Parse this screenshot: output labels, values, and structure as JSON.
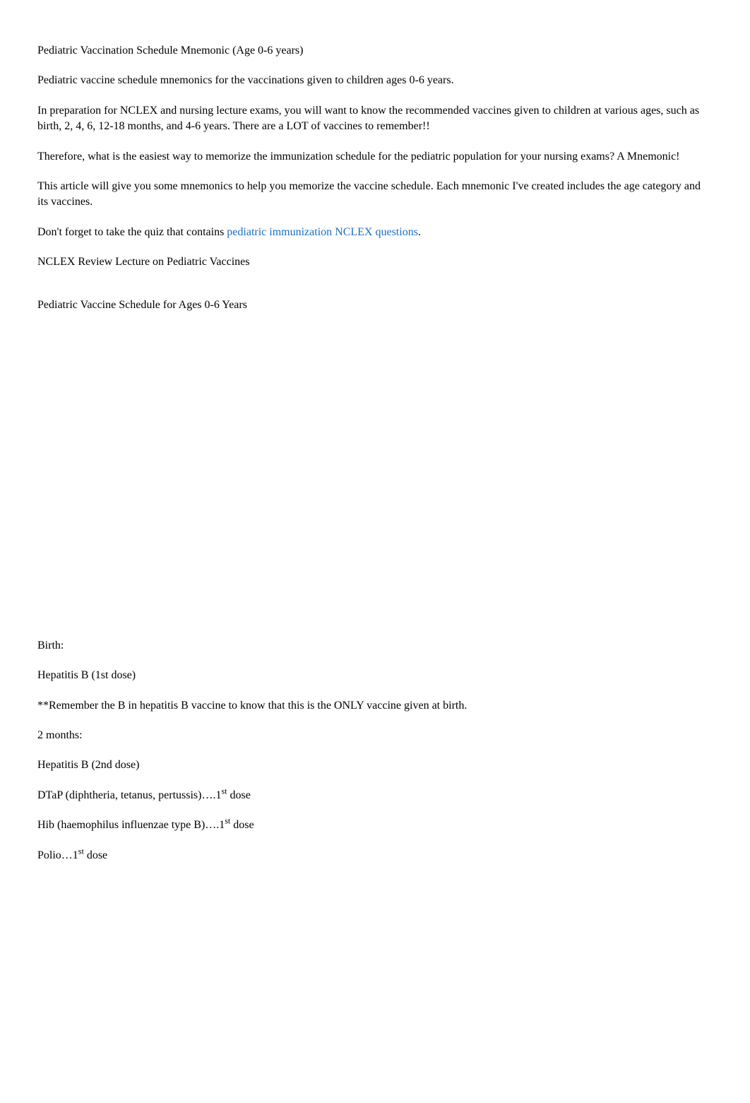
{
  "title": "Pediatric Vaccination Schedule Mnemonic (Age 0-6 years)",
  "intro": {
    "p1_a": "Pediatric vaccine schedule mnemonics",
    "p1_b": "   for the vaccinations given to children ages 0-6 years.",
    "p2": "In preparation for NCLEX and nursing lecture exams, you will want to know the recommended vaccines given to children at various ages, such as birth, 2, 4, 6, 12-18 months, and 4-6 years. There are a LOT of vaccines to remember!!",
    "p3": "Therefore, what is the easiest way to memorize the immunization schedule for the pediatric population for your nursing exams? A Mnemonic!",
    "p4": "This article will give you some mnemonics to help you memorize the vaccine schedule. Each mnemonic I've created includes the age category and its vaccines.",
    "p5_a": "Don't forget to take the quiz that contains  ",
    "p5_link": " pediatric immunization NCLEX questions",
    "p5_b": "."
  },
  "section1_heading": "NCLEX Review Lecture on Pediatric Vaccines",
  "section2_heading": "Pediatric Vaccine Schedule for Ages 0-6 Years",
  "birth": {
    "heading": "Birth:",
    "item1_a": "Hepatitis B",
    "item1_b": " (1st dose)",
    "note_a": "**Remember the ",
    "note_b": "B",
    "note_c": " in hepatitis B",
    "note_d": " vaccine to know that this is the ONLY vaccine given at ",
    "note_e": "birth."
  },
  "two_months": {
    "heading": "2 months:",
    "item1": "Hepatitis B (2nd dose)",
    "item2_a": "DTaP (diphtheria, tetanus, pertussis)….1",
    "item2_sup": "st",
    "item2_b": " dose",
    "item3_a": "Hib (",
    "item3_b": "haemophilus influenzae type B)….1",
    "item3_sup": "st",
    "item3_c": " dose",
    "item4_a": "Polio…1",
    "item4_sup": "st",
    "item4_b": " dose"
  }
}
